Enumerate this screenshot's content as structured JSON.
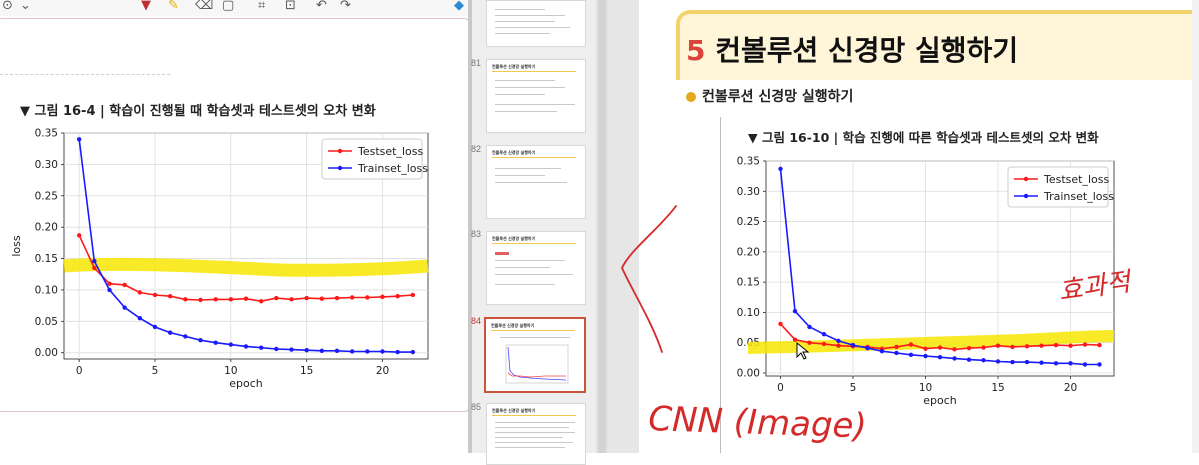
{
  "left_panel": {
    "caption": "▼  그림 16-4 | 학습이 진행될 때 학습셋과 테스트셋의 오차 변화",
    "toolbar_icons": [
      "lasso-icon",
      "pen-icon",
      "highlighter-icon",
      "eraser-icon",
      "shapes-icon",
      "crop-icon",
      "ocr-icon",
      "undo-icon",
      "redo-icon"
    ]
  },
  "thumbnails": [
    {
      "number": "",
      "title": "",
      "selected": false
    },
    {
      "number": "81",
      "title": "컨볼루션 신경망 실행하기",
      "selected": false
    },
    {
      "number": "82",
      "title": "컨볼루션 신경망 실행하기",
      "selected": false
    },
    {
      "number": "83",
      "title": "컨볼루션 신경망 실행하기",
      "selected": false
    },
    {
      "number": "84",
      "title": "컨볼루션 신경망 실행하기",
      "selected": true
    },
    {
      "number": "85",
      "title": "컨볼루션 신경망 실행하기",
      "selected": false
    }
  ],
  "slide": {
    "title_number": "5",
    "title_text": "컨볼루션 신경망 실행하기",
    "bullet": "컨볼루션 신경망 실행하기",
    "caption": "▼  그림 16-10 | 학습 진행에 따른 학습셋과 테스트셋의 오차 변화",
    "annotations": {
      "handwritten_right": "효과적",
      "handwritten_bottom": "CNN (Image)"
    },
    "highlight_color": "#f7e600",
    "ink_color": "#d22a2a"
  },
  "chart_data": [
    {
      "type": "line",
      "title": "",
      "xlabel": "epoch",
      "ylabel": "loss",
      "xlim": [
        -1,
        23
      ],
      "ylim": [
        -0.01,
        0.35
      ],
      "xticks": [
        0,
        5,
        10,
        15,
        20
      ],
      "yticks": [
        0.0,
        0.05,
        0.1,
        0.15,
        0.2,
        0.25,
        0.3,
        0.35
      ],
      "ytick_labels": [
        "0.00",
        "0.05",
        "0.10",
        "0.15",
        "0.20",
        "0.25",
        "0.30",
        "0.35"
      ],
      "grid": true,
      "legend": "top-right",
      "x": [
        0,
        1,
        2,
        3,
        4,
        5,
        6,
        7,
        8,
        9,
        10,
        11,
        12,
        13,
        14,
        15,
        16,
        17,
        18,
        19,
        20,
        21,
        22
      ],
      "series": [
        {
          "name": "Testset_loss",
          "color": "#ff1a1a",
          "values": [
            0.187,
            0.135,
            0.11,
            0.108,
            0.096,
            0.092,
            0.09,
            0.085,
            0.084,
            0.085,
            0.085,
            0.086,
            0.082,
            0.087,
            0.085,
            0.087,
            0.086,
            0.087,
            0.088,
            0.088,
            0.089,
            0.09,
            0.092
          ]
        },
        {
          "name": "Trainset_loss",
          "color": "#1a1aff",
          "values": [
            0.34,
            0.146,
            0.1,
            0.072,
            0.055,
            0.041,
            0.032,
            0.026,
            0.02,
            0.016,
            0.013,
            0.01,
            0.008,
            0.006,
            0.005,
            0.004,
            0.003,
            0.003,
            0.002,
            0.002,
            0.002,
            0.001,
            0.001
          ]
        }
      ]
    },
    {
      "type": "line",
      "title": "",
      "xlabel": "epoch",
      "ylabel": "loss",
      "xlim": [
        -1,
        23
      ],
      "ylim": [
        -0.005,
        0.35
      ],
      "xticks": [
        0,
        5,
        10,
        15,
        20
      ],
      "yticks": [
        0.0,
        0.05,
        0.1,
        0.15,
        0.2,
        0.25,
        0.3,
        0.35
      ],
      "ytick_labels": [
        "0.00",
        "0.05",
        "0.10",
        "0.15",
        "0.20",
        "0.25",
        "0.30",
        "0.35"
      ],
      "grid": true,
      "legend": "top-right",
      "x": [
        0,
        1,
        2,
        3,
        4,
        5,
        6,
        7,
        8,
        9,
        10,
        11,
        12,
        13,
        14,
        15,
        16,
        17,
        18,
        19,
        20,
        21,
        22
      ],
      "series": [
        {
          "name": "Testset_loss",
          "color": "#ff1a1a",
          "values": [
            0.081,
            0.055,
            0.05,
            0.048,
            0.045,
            0.044,
            0.043,
            0.04,
            0.043,
            0.047,
            0.04,
            0.042,
            0.039,
            0.041,
            0.042,
            0.045,
            0.043,
            0.044,
            0.045,
            0.046,
            0.045,
            0.047,
            0.046
          ]
        },
        {
          "name": "Trainset_loss",
          "color": "#1a1aff",
          "values": [
            0.337,
            0.102,
            0.076,
            0.064,
            0.053,
            0.046,
            0.041,
            0.036,
            0.033,
            0.03,
            0.028,
            0.026,
            0.024,
            0.022,
            0.021,
            0.019,
            0.018,
            0.018,
            0.017,
            0.016,
            0.016,
            0.014,
            0.014
          ]
        }
      ]
    }
  ]
}
